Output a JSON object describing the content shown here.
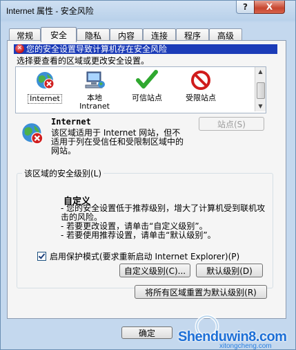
{
  "window": {
    "title": "Internet 属性 - 安全风险",
    "help_label": "?",
    "close_label": "X"
  },
  "tabs": [
    {
      "label": "常规",
      "active": false
    },
    {
      "label": "安全",
      "active": true
    },
    {
      "label": "隐私",
      "active": false
    },
    {
      "label": "内容",
      "active": false
    },
    {
      "label": "连接",
      "active": false
    },
    {
      "label": "程序",
      "active": false
    },
    {
      "label": "高级",
      "active": false
    }
  ],
  "warning_banner": "您的安全设置导致计算机存在安全风险",
  "zone_prompt": "选择要查看的区域或更改安全设置。",
  "zones": [
    {
      "label": "Internet",
      "icon": "globe-warning-icon",
      "selected": true
    },
    {
      "label": "本地\nIntranet",
      "icon": "local-intranet-icon",
      "selected": false
    },
    {
      "label": "可信站点",
      "icon": "trusted-checkmark-icon",
      "selected": false
    },
    {
      "label": "受限站点",
      "icon": "restricted-no-entry-icon",
      "selected": false
    }
  ],
  "zone_info": {
    "title": "Internet",
    "description": "该区域适用于 Internet 网站，但不适用于列在受信任和受限制区域中的网站。",
    "sites_button": "站点(S)"
  },
  "security_level": {
    "group_label": "该区域的安全级别(L)",
    "level_title": "自定义",
    "lines": [
      "- 您的安全设置低于推荐级别，增大了计算机受到联机攻击的风险。",
      "- 若要更改设置，请单击“自定义级别”。",
      "- 若要使用推荐设置，请单击“默认级别”。"
    ],
    "protected_mode_label": "启用保护模式(要求重新启动 Internet Explorer)(P)",
    "protected_mode_checked": true,
    "custom_level_button": "自定义级别(C)...",
    "default_level_button": "默认级别(D)"
  },
  "reset_all_button": "将所有区域重置为默认级别(R)",
  "ok_button": "确定",
  "watermark": {
    "text": "Shenduwin8.com",
    "sub": "xitongcheng.com"
  },
  "colors": {
    "banner_bg": "#1c3cb8",
    "title_gradient": "#b9d1ea",
    "trusted_green": "#2fa82f",
    "restricted_red": "#d01c1c"
  }
}
